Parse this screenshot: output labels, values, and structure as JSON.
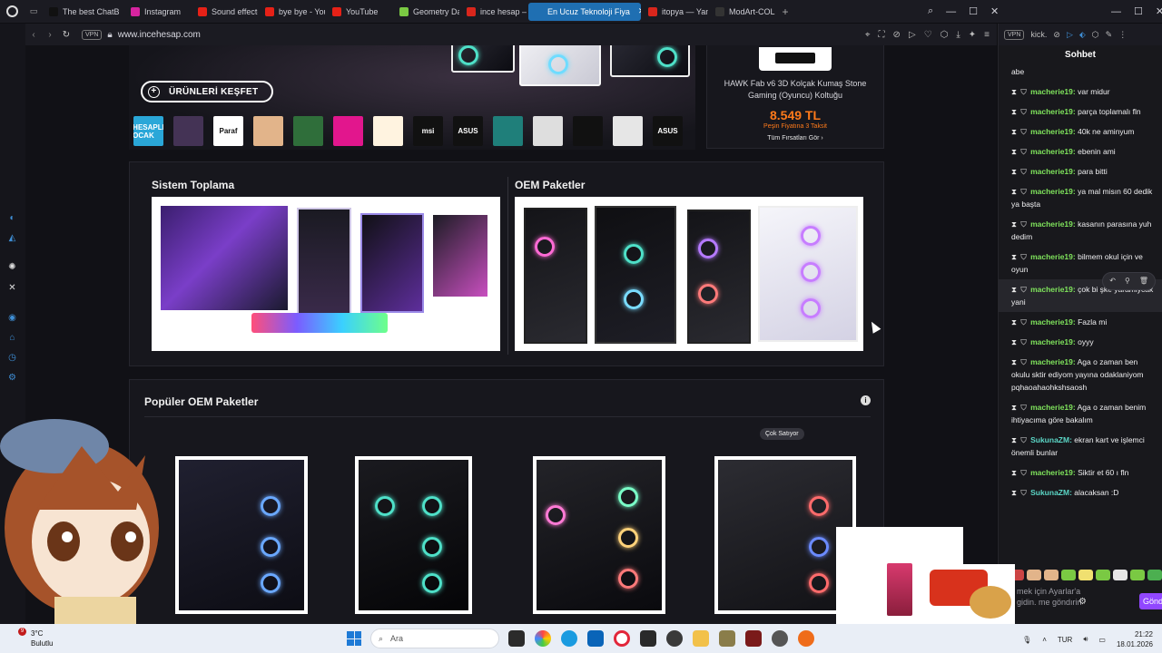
{
  "tabs": [
    {
      "label": "The best ChatB",
      "color": "#111111"
    },
    {
      "label": "Instagram",
      "color": "#d6249f"
    },
    {
      "label": "Sound effect-[w",
      "color": "#e62117"
    },
    {
      "label": "bye bye - YouTu",
      "color": "#e62117"
    },
    {
      "label": "YouTube",
      "color": "#e62117"
    },
    {
      "label": "Geometry Dash",
      "color": "#7ac943"
    },
    {
      "label": "ince hesap — Ya",
      "color": "#d9261c"
    },
    {
      "label": "En Ucuz Teknoloji Fiya",
      "color": "#1f6fb2",
      "active": true
    },
    {
      "label": "itopya — Yande",
      "color": "#d9261c"
    },
    {
      "label": "ModArt-COLD /",
      "color": "#333333"
    }
  ],
  "address": {
    "vpn": "VPN",
    "url": "www.incehesap.com"
  },
  "hero": {
    "cta": "ÜRÜNLERİ KEŞFET"
  },
  "brands": [
    {
      "label": "HESAPLI OCAK",
      "color": "#2aa7d8"
    },
    {
      "label": "",
      "color": "#443355"
    },
    {
      "label": "Paraf",
      "color": "#ffffff"
    },
    {
      "label": "",
      "color": "#e2b48a"
    },
    {
      "label": "",
      "color": "#2f6e3a"
    },
    {
      "label": "",
      "color": "#e2168d"
    },
    {
      "label": "",
      "color": "#fff3e0"
    },
    {
      "label": "msi",
      "color": "#111111"
    },
    {
      "label": "ASUS",
      "color": "#111111"
    },
    {
      "label": "",
      "color": "#1f7f7a"
    },
    {
      "label": "",
      "color": "#dedede"
    },
    {
      "label": "",
      "color": "#111111"
    },
    {
      "label": "",
      "color": "#e6e6e6"
    },
    {
      "label": "ASUS",
      "color": "#111111"
    }
  ],
  "deal": {
    "name": "HAWK Fab v6 3D Kolçak Kumaş Stone Gaming (Oyuncu) Koltuğu",
    "price": "8.549 TL",
    "installment": "Peşin Fiyatına 3 Taksit",
    "all": "Tüm Fırsatları Gör ›"
  },
  "systems": {
    "left_title": "Sistem Toplama",
    "right_title": "OEM Paketler"
  },
  "popular": {
    "title": "Popüler OEM Paketler",
    "badge": "Çok Satıyor"
  },
  "chat": {
    "vpn": "VPN",
    "search": "kick.",
    "header": "Sohbet",
    "first_line": "abe",
    "messages": [
      {
        "user": "macherie19",
        "text": "var midur",
        "color": "#7fe35c"
      },
      {
        "user": "macherie19",
        "text": "parça toplamalı fln",
        "color": "#7fe35c"
      },
      {
        "user": "macherie19",
        "text": "40k ne aminyum",
        "color": "#7fe35c"
      },
      {
        "user": "macherie19",
        "text": "ebenin ami",
        "color": "#7fe35c"
      },
      {
        "user": "macherie19",
        "text": "para bitti",
        "color": "#7fe35c"
      },
      {
        "user": "macherie19",
        "text": "ya mal misın 60 dedik ya başta",
        "color": "#7fe35c"
      },
      {
        "user": "macherie19",
        "text": "kasanın parasına yuh dedim",
        "color": "#7fe35c"
      },
      {
        "user": "macherie19",
        "text": "bilmem okul için ve oyun",
        "color": "#7fe35c"
      },
      {
        "user": "macherie19",
        "text": "çok bi şke yaramiycak yani",
        "color": "#7fe35c",
        "highlight": true
      },
      {
        "user": "macherie19",
        "text": "Fazla mi",
        "color": "#7fe35c"
      },
      {
        "user": "macherie19",
        "text": "oyyy",
        "color": "#7fe35c"
      },
      {
        "user": "macherie19",
        "text": "Aga o zaman ben okulu sktir ediyom yayına odaklaniyom pqhaoahaohkshsaosh",
        "color": "#7fe35c"
      },
      {
        "user": "macherie19",
        "text": "Aga o zaman benim ihtiyacıma göre bakalım",
        "color": "#7fe35c"
      },
      {
        "user": "SukunaZM",
        "text": "ekran kart ve işlemci önemli bunlar",
        "color": "#5bd6c6"
      },
      {
        "user": "macherie19",
        "text": "Siktir et 60 ı fln",
        "color": "#7fe35c"
      },
      {
        "user": "SukunaZM",
        "text": "alacaksan :D",
        "color": "#5bd6c6"
      }
    ],
    "input_placeholder": "mek için Ayarlar'a gidin. me göndırin",
    "send": "Gönd"
  },
  "taskbar": {
    "weather_temp": "3°C",
    "weather_desc": "Bulutlu",
    "weather_badge": "9",
    "search": "Ara",
    "lang": "TUR",
    "time": "21:22",
    "date": "18.01.2026"
  }
}
